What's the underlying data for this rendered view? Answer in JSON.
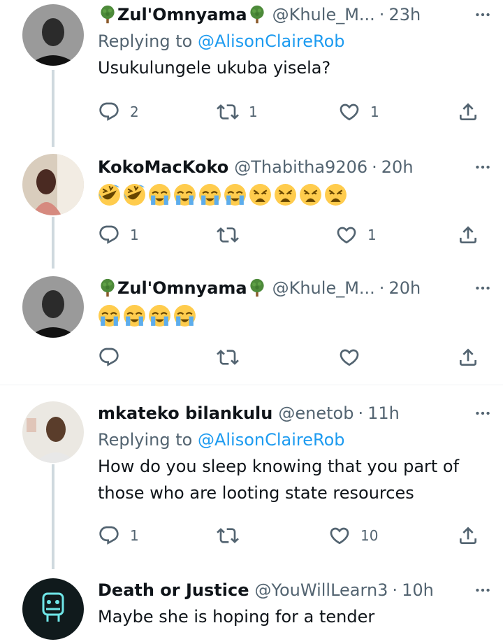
{
  "tweets": [
    {
      "name": "Zul'Omnyama",
      "handle": "@Khule_M...",
      "time": "23h",
      "reply_label": "Replying to",
      "reply_mention": "@AlisonClaireRob",
      "text": "Usukulungele ukuba yisela?",
      "replies": "2",
      "retweets": "1",
      "likes": "1"
    },
    {
      "name": "KokoMacKoko",
      "handle": "@Thabitha9206",
      "time": "20h",
      "emoji_sequence": [
        "rofl",
        "rofl",
        "sob",
        "sob",
        "sob",
        "sob",
        "weary",
        "weary",
        "weary",
        "weary"
      ],
      "replies": "1",
      "retweets": "",
      "likes": "1"
    },
    {
      "name": "Zul'Omnyama",
      "handle": "@Khule_M...",
      "time": "20h",
      "emoji_sequence": [
        "sob",
        "sob",
        "sob",
        "sob"
      ],
      "replies": "",
      "retweets": "",
      "likes": ""
    },
    {
      "name": "mkateko bilankulu",
      "handle": "@enetob",
      "time": "11h",
      "reply_label": "Replying to",
      "reply_mention": "@AlisonClaireRob",
      "text_line1": "How do you sleep knowing that you part of",
      "text_line2": "those who are looting state resources",
      "replies": "1",
      "retweets": "",
      "likes": "10"
    },
    {
      "name": "Death or Justice",
      "handle": "@YouWillLearn3",
      "time": "10h",
      "text": "Maybe she is hoping for a tender"
    }
  ],
  "separator": "·",
  "colors": {
    "accent": "#1d9bf0",
    "secondary_text": "#536471",
    "thread_line": "#cfd9de"
  }
}
